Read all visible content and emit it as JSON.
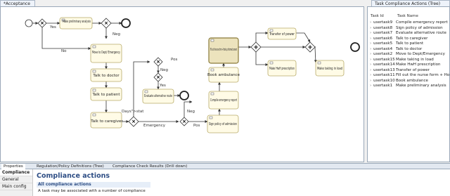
{
  "editor": {
    "tab_label": "*Acceptance",
    "nodes": {
      "make_prelim": "Make preliminary analysis",
      "move_dept": "Move to Dept/ Emergency",
      "talk_doctor": "Talk to doctor",
      "talk_patient": "Talk to patient",
      "talk_caregiver": "Talk to caregiver",
      "evaluate_alt": "Evaluate alternative route",
      "fill_form": "Fill out the nurse form + Hook up informed consent",
      "book_ambulance": "Book ambulance",
      "compile_report": "Compile emergency report",
      "sign_policy": "Sign policy of admission",
      "transfer_power": "Transfer of power",
      "make_hwf": "Make HwH prescription",
      "make_taking": "Make taking in load"
    },
    "edge_labels": {
      "yes1": "Yes",
      "no1": "No",
      "neg1": "Neg",
      "pos1": "Pos",
      "neg2": "Neg",
      "yes2": "Yes",
      "days": "Days\">stat",
      "emergency": "Emergency",
      "neg3": "Neg",
      "pos2": "Pos"
    }
  },
  "task_view": {
    "tab_label": "Task Compliance Actions (Tree)",
    "col_id": "Task Id",
    "col_name": "Task Name",
    "rows": [
      {
        "id": "usertask9",
        "name": "Compile emergency report"
      },
      {
        "id": "usertask8",
        "name": "Sign policy of admission"
      },
      {
        "id": "usertask7",
        "name": "Evaluate alternative route"
      },
      {
        "id": "usertask6",
        "name": "Talk to caregiver"
      },
      {
        "id": "usertask5",
        "name": "Talk to patient"
      },
      {
        "id": "usertask4",
        "name": "Talk to doctor"
      },
      {
        "id": "usertask2",
        "name": "Move to Dept/Emergency"
      },
      {
        "id": "usertask15",
        "name": "Make taking in load"
      },
      {
        "id": "usertask14",
        "name": "Make HwH prescription"
      },
      {
        "id": "usertask13",
        "name": "Transfer of power"
      },
      {
        "id": "usertask11",
        "name": "Fill out the nurse form + Ho..."
      },
      {
        "id": "usertask10",
        "name": "Book ambulance"
      },
      {
        "id": "usertask1",
        "name": "Make preliminary analysis"
      }
    ]
  },
  "bottom_tabs": [
    "Properties",
    "Regulation/Policy Definitions (Tree)",
    "Compliance Check Results (Drill down)"
  ],
  "properties": {
    "side_items": [
      "Compliance",
      "General",
      "Main config"
    ],
    "title": "Compliance actions",
    "section": "All compliance actions",
    "description": "A task may be associated with a number of compliance"
  }
}
